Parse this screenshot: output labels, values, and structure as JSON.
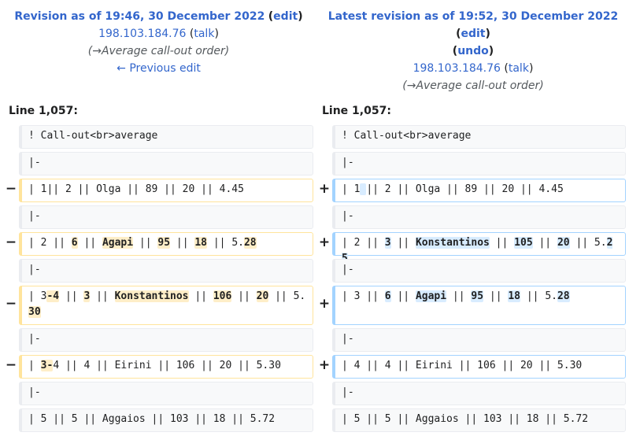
{
  "left_header": {
    "title": "Revision as of 19:46, 30 December 2022",
    "edit": "edit",
    "user": "198.103.184.76",
    "talk": "talk",
    "summary": "(→Average call-out order)",
    "prev": "← Previous edit"
  },
  "right_header": {
    "title": "Latest revision as of 19:52, 30 December 2022",
    "edit": "edit",
    "undo": "undo",
    "user": "198.103.184.76",
    "talk": "talk",
    "summary": "(→Average call-out order)"
  },
  "line_label": "Line 1,057:",
  "markers": {
    "minus": "−",
    "plus": "+"
  },
  "rows": [
    {
      "type": "context",
      "left": "! Call-out<br>average",
      "right": "! Call-out<br>average"
    },
    {
      "type": "context",
      "left": "|-",
      "right": "|-"
    },
    {
      "type": "change",
      "left": [
        {
          "t": "| 1|| 2 || Olga || 89 || 20 || 4.45"
        }
      ],
      "right": [
        {
          "t": "| 1"
        },
        {
          "t": " ",
          "h": 1
        },
        {
          "t": "|| 2 || Olga || 89 || 20 || 4.45"
        }
      ]
    },
    {
      "type": "context",
      "left": "|-",
      "right": "|-"
    },
    {
      "type": "change",
      "left": [
        {
          "t": "| 2 || "
        },
        {
          "t": "6",
          "h": 1
        },
        {
          "t": " || "
        },
        {
          "t": "Agapi",
          "h": 1
        },
        {
          "t": " || "
        },
        {
          "t": "95",
          "h": 1
        },
        {
          "t": " || "
        },
        {
          "t": "18",
          "h": 1
        },
        {
          "t": " || 5."
        },
        {
          "t": "28",
          "h": 1
        }
      ],
      "right": [
        {
          "t": "| 2 || "
        },
        {
          "t": "3",
          "h": 1
        },
        {
          "t": " || "
        },
        {
          "t": "Konstantinos",
          "h": 1
        },
        {
          "t": " || "
        },
        {
          "t": "105",
          "h": 1
        },
        {
          "t": " || "
        },
        {
          "t": "20",
          "h": 1
        },
        {
          "t": " || 5."
        },
        {
          "t": "25",
          "h": 1
        }
      ]
    },
    {
      "type": "context",
      "left": "|-",
      "right": "|-"
    },
    {
      "type": "change",
      "left": [
        {
          "t": "| 3"
        },
        {
          "t": "-4",
          "h": 1
        },
        {
          "t": " || "
        },
        {
          "t": "3",
          "h": 1
        },
        {
          "t": " || "
        },
        {
          "t": "Konstantinos",
          "h": 1
        },
        {
          "t": " || "
        },
        {
          "t": "106",
          "h": 1
        },
        {
          "t": " || "
        },
        {
          "t": "20",
          "h": 1
        },
        {
          "t": " || 5."
        },
        {
          "t": "30",
          "h": 1
        }
      ],
      "right": [
        {
          "t": "| 3 || "
        },
        {
          "t": "6",
          "h": 1
        },
        {
          "t": " || "
        },
        {
          "t": "Agapi",
          "h": 1
        },
        {
          "t": " || "
        },
        {
          "t": "95",
          "h": 1
        },
        {
          "t": " || "
        },
        {
          "t": "18",
          "h": 1
        },
        {
          "t": " || 5."
        },
        {
          "t": "28",
          "h": 1
        }
      ]
    },
    {
      "type": "context",
      "left": "|-",
      "right": "|-"
    },
    {
      "type": "change",
      "left": [
        {
          "t": "| "
        },
        {
          "t": "3-",
          "h": 1
        },
        {
          "t": "4 || 4 || Eirini || 106 || 20 || 5.30"
        }
      ],
      "right": [
        {
          "t": "| 4 || 4 || Eirini || 106 || 20 || 5.30"
        }
      ]
    },
    {
      "type": "context",
      "left": "|-",
      "right": "|-"
    },
    {
      "type": "context",
      "left": "| 5 || 5 || Aggaios || 103 || 18 || 5.72",
      "right": "| 5 || 5 || Aggaios || 103 || 18 || 5.72"
    }
  ]
}
